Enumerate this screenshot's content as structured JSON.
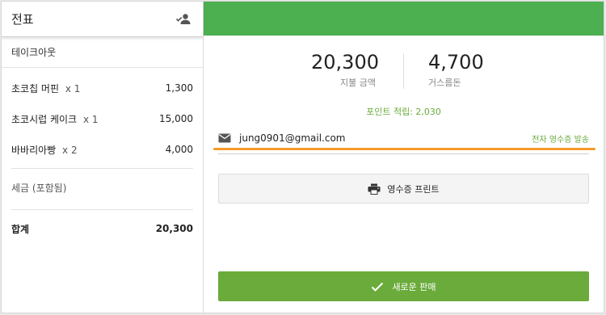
{
  "order_panel": {
    "title": "전표",
    "order_type": "테이크아웃",
    "items": [
      {
        "name": "초코칩 머핀",
        "qty": "x 1",
        "price": "1,300"
      },
      {
        "name": "초코시럽 케이크",
        "qty": "x 1",
        "price": "15,000"
      },
      {
        "name": "바바리아빵",
        "qty": "x 2",
        "price": "4,000"
      }
    ],
    "tax_label": "세금 (포함됨)",
    "total_label": "합계",
    "total_value": "20,300"
  },
  "payment": {
    "paid_amount": "20,300",
    "paid_label": "지불 금액",
    "change_amount": "4,700",
    "change_label": "거스름돈",
    "points_text": "포인트 적립: 2,030"
  },
  "email": {
    "address": "jung0901@gmail.com",
    "send_label": "전자 영수증 발송"
  },
  "buttons": {
    "print_label": "영수증 프린트",
    "new_sale_label": "새로운 판매"
  },
  "colors": {
    "topbar": "#4caf50",
    "accent_green": "#6aab3b",
    "highlight_orange": "#f39a2b"
  },
  "icons": {
    "customer": "person-check-icon",
    "email": "envelope-icon",
    "print": "printer-icon",
    "new_sale": "checkmark-icon"
  }
}
